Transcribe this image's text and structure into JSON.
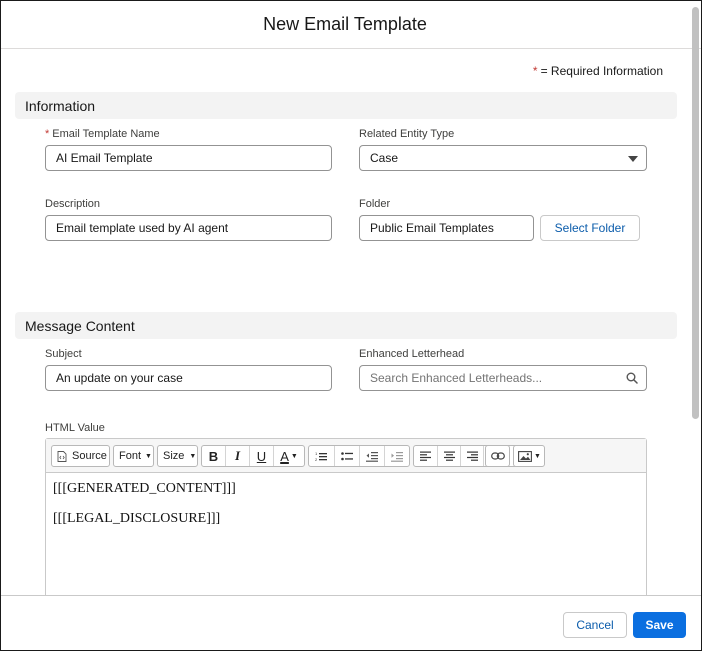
{
  "modal": {
    "title": "New Email Template"
  },
  "required_info": {
    "star": "*",
    "text": "= Required Information"
  },
  "sections": {
    "information": "Information",
    "message_content": "Message Content"
  },
  "fields": {
    "template_name": {
      "required": "*",
      "label": "Email Template Name",
      "value": "AI Email Template"
    },
    "related_entity": {
      "label": "Related Entity Type",
      "value": "Case"
    },
    "description": {
      "label": "Description",
      "value": "Email template used by AI agent"
    },
    "folder": {
      "label": "Folder",
      "value": "Public Email Templates",
      "button": "Select Folder"
    },
    "subject": {
      "label": "Subject",
      "value": "An update on your case"
    },
    "letterhead": {
      "label": "Enhanced Letterhead",
      "placeholder": "Search Enhanced Letterheads..."
    },
    "html_value": {
      "label": "HTML Value"
    }
  },
  "toolbar": {
    "source": "Source",
    "font": "Font",
    "size": "Size",
    "bold": "B",
    "italic": "I",
    "underline": "U",
    "text_color": "A"
  },
  "editor": {
    "lines": [
      "[[[GENERATED_CONTENT]]]",
      "[[[LEGAL_DISCLOSURE]]]"
    ]
  },
  "footer": {
    "cancel": "Cancel",
    "save": "Save"
  },
  "colors": {
    "brand": "#0b6fe0",
    "link": "#0b5cab",
    "required": "#c23934",
    "section_bg": "#f3f3f3"
  }
}
